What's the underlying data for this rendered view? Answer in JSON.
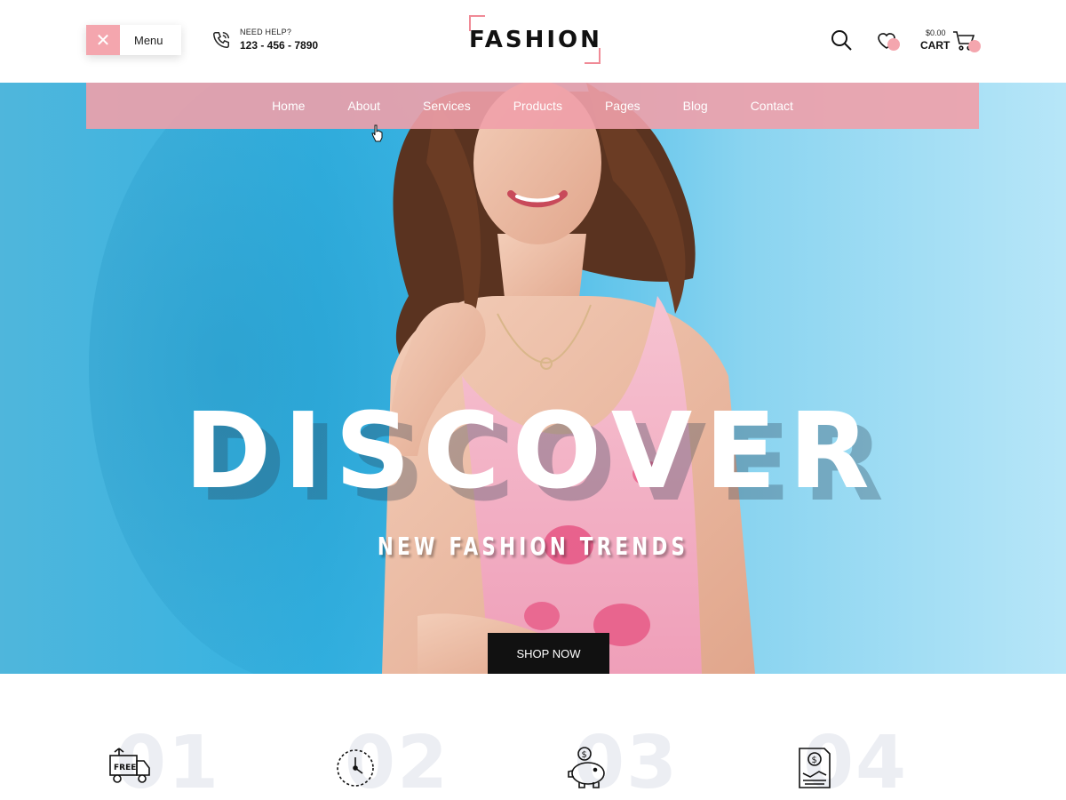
{
  "header": {
    "menu_label": "Menu",
    "help_label": "NEED HELP?",
    "phone": "123 - 456 - 7890",
    "logo": "FASHION",
    "cart_price": "$0.00",
    "cart_label": "CART"
  },
  "nav": {
    "items": [
      "Home",
      "About",
      "Services",
      "Products",
      "Pages",
      "Blog",
      "Contact"
    ]
  },
  "hero": {
    "headline": "DISCOVER",
    "subline": "NEW FASHION TRENDS",
    "button": "SHOP NOW"
  },
  "features": [
    {
      "num": "01",
      "icon": "free-delivery-truck-icon",
      "icon_text": "FREE"
    },
    {
      "num": "02",
      "icon": "clock-icon"
    },
    {
      "num": "03",
      "icon": "piggy-bank-icon"
    },
    {
      "num": "04",
      "icon": "payment-document-icon"
    }
  ],
  "colors": {
    "accent": "#f4a6ae",
    "nav_bg": "#f0a0aa",
    "hero_blue": "#33b2e2",
    "button_bg": "#111111"
  }
}
